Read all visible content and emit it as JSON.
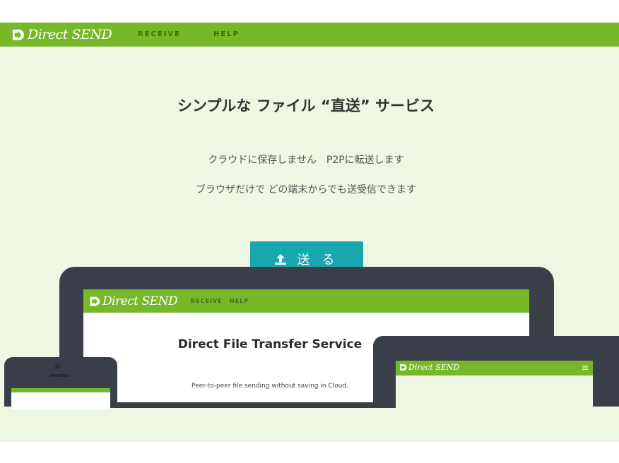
{
  "app": {
    "logo_text": "Direct SEND",
    "nav": [
      {
        "label": "RECEIVE"
      },
      {
        "label": "HELP"
      }
    ]
  },
  "hero": {
    "title": "シンプルな ファイル “直送” サービス",
    "line1": "クラウドに保存しません　P2Pに転送します",
    "line2": "ブラウザだけで どの端末からでも送受信できます",
    "send_button": {
      "label": "送 る",
      "icon": "upload-icon"
    }
  },
  "mockup": {
    "laptop": {
      "logo_text": "Direct SEND",
      "nav": [
        {
          "label": "RECEIVE"
        },
        {
          "label": "HELP"
        }
      ],
      "title": "Direct File Transfer Service",
      "subtitle": "Peer-to-peer file sending without saving in Cloud."
    },
    "tablet": {
      "logo_text": "Direct SEND",
      "menu_icon": "hamburger-menu-icon",
      "menu_glyph": "≡"
    }
  },
  "colors": {
    "brand_green": "#76b82a",
    "hero_bg": "#eef7e3",
    "button_teal": "#19a6ad",
    "device_frame": "#3a3e48"
  }
}
